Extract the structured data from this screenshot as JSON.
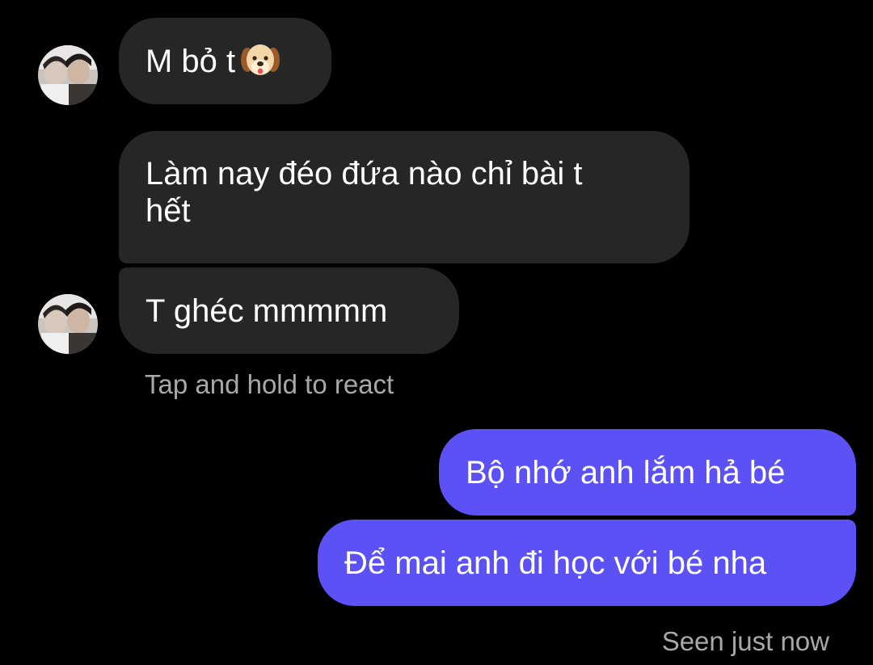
{
  "colors": {
    "background": "#000000",
    "incoming_bubble": "#262626",
    "outgoing_bubble": "#5b51f5",
    "meta_text": "#a8a8a8"
  },
  "thread": {
    "incoming": [
      {
        "text": "M bỏ t",
        "emoji": "dog-face-icon"
      },
      {
        "line1": "Làm nay đéo đứa nào chỉ bài t",
        "line2": "hết"
      },
      {
        "text": "T ghéc mmmmm"
      }
    ],
    "react_hint": "Tap and hold to react",
    "outgoing": [
      {
        "text": "Bộ nhớ anh lắm hả bé"
      },
      {
        "text": "Để mai anh đi học với bé nha"
      }
    ],
    "seen_status": "Seen just now"
  }
}
